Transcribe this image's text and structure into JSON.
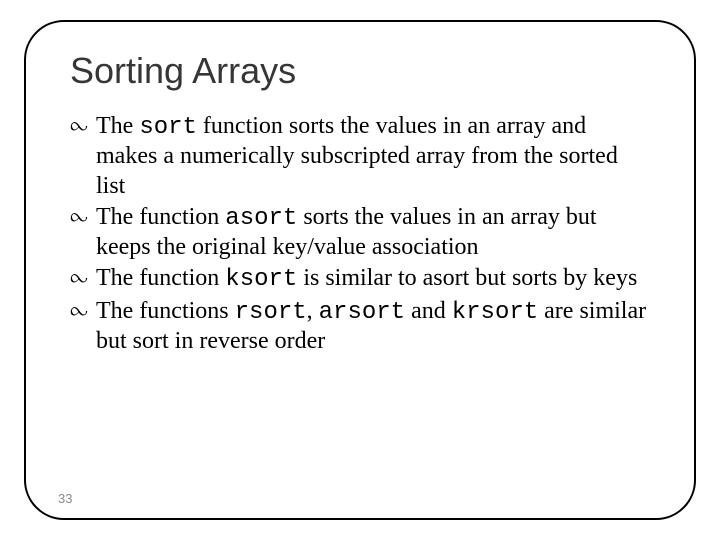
{
  "title": "Sorting Arrays",
  "bullet_glyph": "་",
  "items": [
    {
      "pre": "The ",
      "code1": "sort",
      "mid": " function sorts the values in an array and makes a numerically subscripted array from the sorted list",
      "code2": "",
      "mid2": "",
      "code3": "",
      "tail": ""
    },
    {
      "pre": "The function  ",
      "code1": "asort",
      "mid": " sorts the values in an array but keeps the original key/value association",
      "code2": "",
      "mid2": "",
      "code3": "",
      "tail": ""
    },
    {
      "pre": "The function ",
      "code1": "ksort",
      "mid": "  is similar to asort but sorts by keys",
      "code2": "",
      "mid2": "",
      "code3": "",
      "tail": ""
    },
    {
      "pre": "The functions ",
      "code1": "rsort",
      "mid": ", ",
      "code2": "arsort",
      "mid2": " and ",
      "code3": "krsort",
      "tail": " are similar but sort in reverse order"
    }
  ],
  "page_number": "33"
}
